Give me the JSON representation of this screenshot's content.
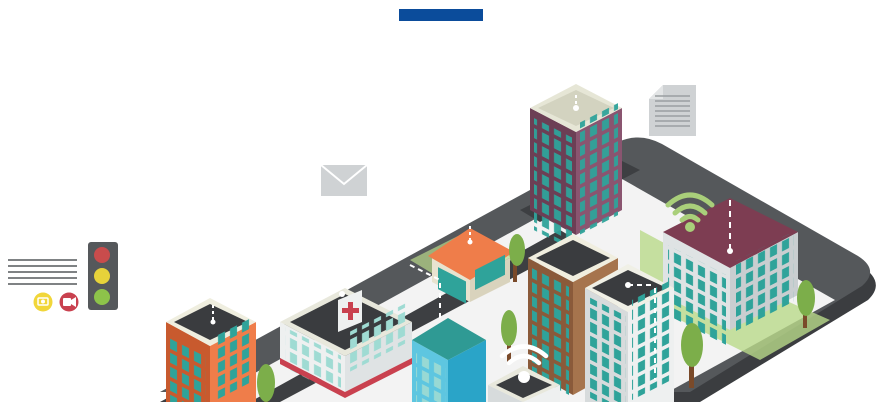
{
  "colors": {
    "accent_bar": "#0b4c9b",
    "platform": "#55585b",
    "platform_side": "#3b3d40",
    "ground": "#f3f3f3",
    "grass": "#b9d98a",
    "road": "#3d3f42",
    "glass": "#2fa39a",
    "tree": "#7cae4a",
    "tree_trunk": "#7a4a2a",
    "wifi": "#a9cf7a",
    "icon_gray": "#cfd2d4",
    "light_red": "#c94c4c",
    "light_yellow": "#e6d23a",
    "light_green": "#8dc34a",
    "camera_yellow": "#f1d63a",
    "camera_red": "#c9414f"
  },
  "icons": [
    "traffic-light-icon",
    "document-icon",
    "envelope-icon",
    "wifi-icon",
    "photo-camera-icon",
    "video-camera-icon",
    "hospital-cross-icon"
  ],
  "buildings": [
    "tall-purple-tower",
    "orange-shop",
    "hospital",
    "orange-apartment",
    "brown-tower",
    "gray-office",
    "maroon-office",
    "teal-apartment",
    "small-wifi-building"
  ]
}
